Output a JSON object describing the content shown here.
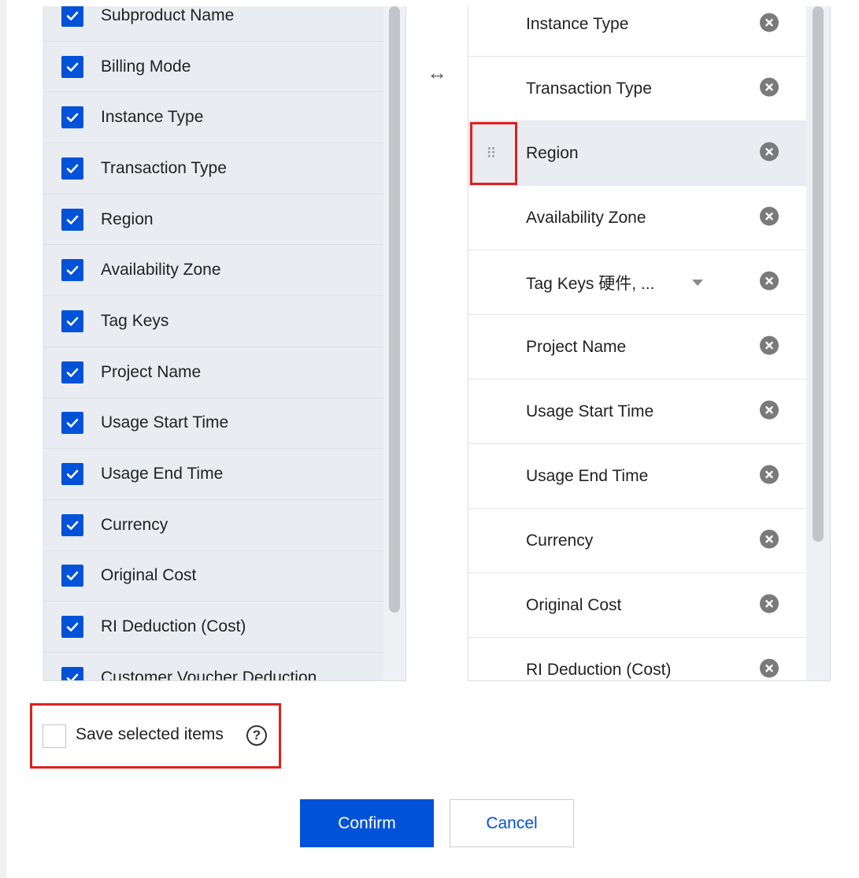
{
  "left_panel": {
    "items": [
      {
        "label": "Subproduct Name",
        "checked": true
      },
      {
        "label": "Billing Mode",
        "checked": true
      },
      {
        "label": "Instance Type",
        "checked": true
      },
      {
        "label": "Transaction Type",
        "checked": true
      },
      {
        "label": "Region",
        "checked": true
      },
      {
        "label": "Availability Zone",
        "checked": true
      },
      {
        "label": "Tag Keys",
        "checked": true
      },
      {
        "label": "Project Name",
        "checked": true
      },
      {
        "label": "Usage Start Time",
        "checked": true
      },
      {
        "label": "Usage End Time",
        "checked": true
      },
      {
        "label": "Currency",
        "checked": true
      },
      {
        "label": "Original Cost",
        "checked": true
      },
      {
        "label": "RI Deduction (Cost)",
        "checked": true
      },
      {
        "label": "Customer Voucher Deduction",
        "checked": true
      }
    ]
  },
  "swap_icon": "↔",
  "right_panel": {
    "items": [
      {
        "label": "Instance Type"
      },
      {
        "label": "Transaction Type"
      },
      {
        "label": "Region",
        "active": true
      },
      {
        "label": "Availability Zone"
      },
      {
        "label": "Tag Keys 硬件, ...",
        "has_dropdown": true
      },
      {
        "label": "Project Name"
      },
      {
        "label": "Usage Start Time"
      },
      {
        "label": "Usage End Time"
      },
      {
        "label": "Currency"
      },
      {
        "label": "Original Cost"
      },
      {
        "label": "RI Deduction (Cost)"
      }
    ]
  },
  "save_selected": {
    "label": "Save selected items",
    "help_icon": "?",
    "checked": false
  },
  "buttons": {
    "confirm": "Confirm",
    "cancel": "Cancel"
  },
  "colors": {
    "primary": "#0052d9",
    "highlight": "#e02020"
  }
}
